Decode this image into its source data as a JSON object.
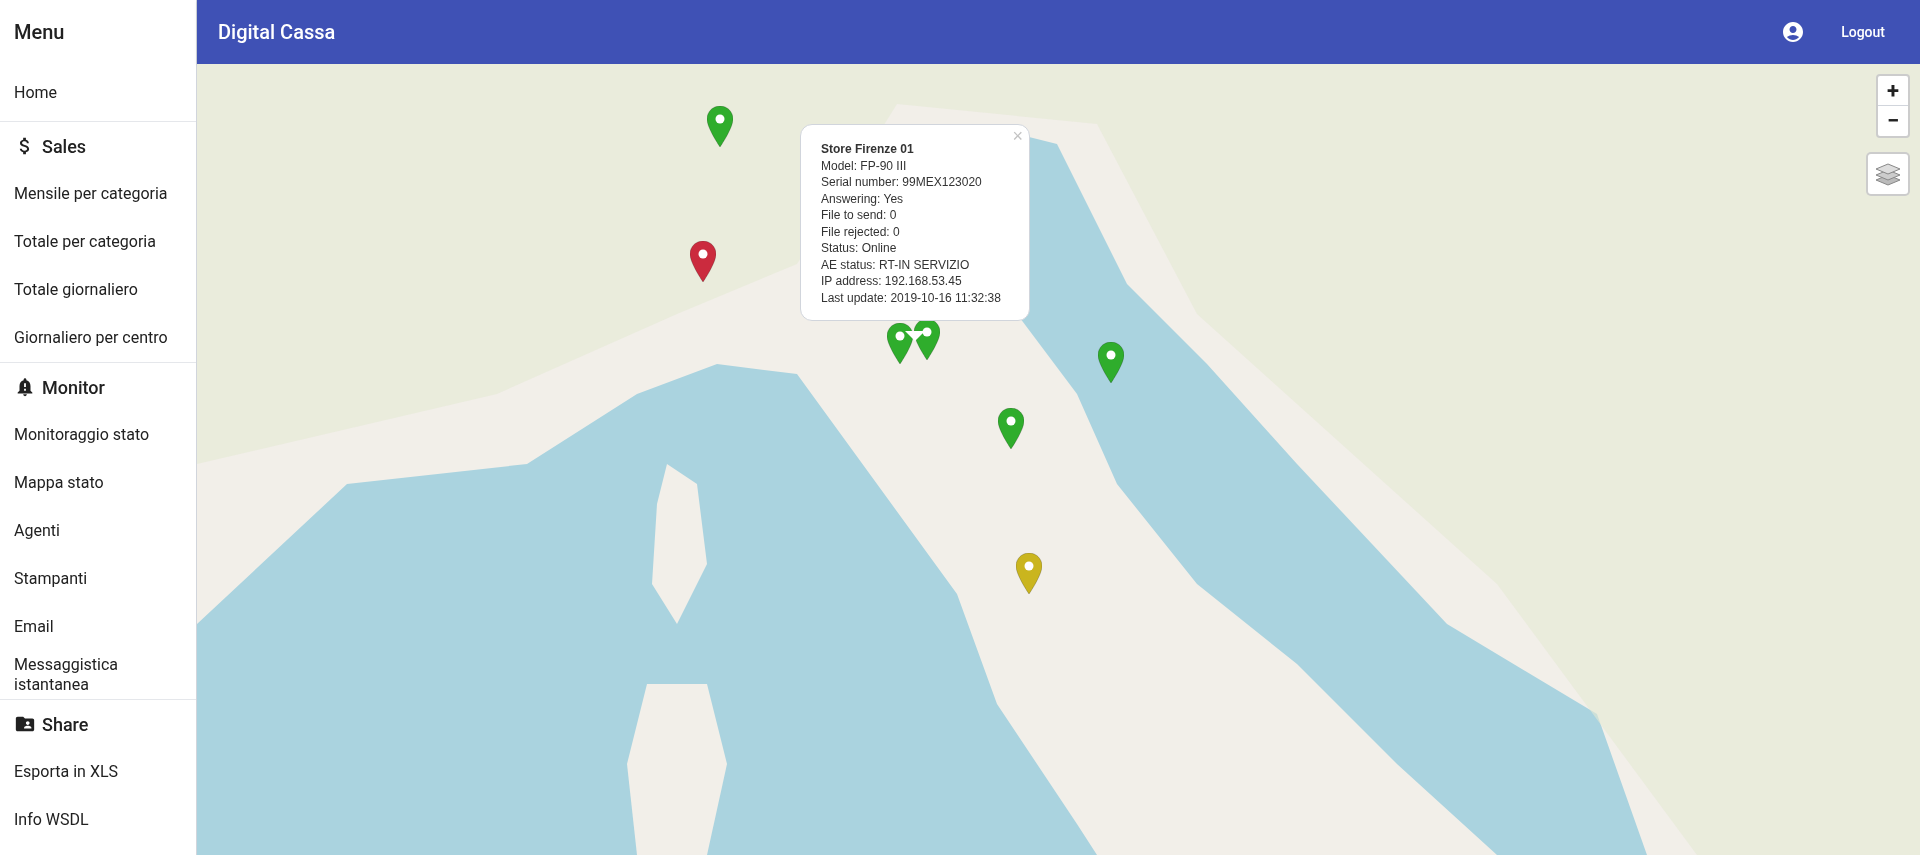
{
  "sidebar": {
    "title": "Menu",
    "home": "Home",
    "sections": [
      {
        "heading": "Sales",
        "items": [
          "Mensile per categoria",
          "Totale per categoria",
          "Totale giornaliero",
          "Giornaliero per centro"
        ]
      },
      {
        "heading": "Monitor",
        "items": [
          "Monitoraggio stato",
          "Mappa stato",
          "Agenti",
          "Stampanti",
          "Email",
          "Messaggistica istantanea"
        ]
      },
      {
        "heading": "Share",
        "items": [
          "Esporta in XLS",
          "Info WSDL"
        ]
      }
    ]
  },
  "header": {
    "title": "Digital Cassa",
    "logout": "Logout"
  },
  "map": {
    "zoom_in": "+",
    "zoom_out": "−",
    "markers": [
      {
        "color": "#2fad2c"
      },
      {
        "color": "#cb2b3e"
      },
      {
        "color": "#2fad2c"
      },
      {
        "color": "#2fad2c"
      },
      {
        "color": "#2fad2c"
      },
      {
        "color": "#2fad2c"
      },
      {
        "color": "#cab51e"
      }
    ],
    "popup": {
      "close": "×",
      "title": "Store Firenze 01",
      "lines": [
        "Model: FP-90 III",
        "Serial number: 99MEX123020",
        "Answering: Yes",
        "File to send: 0",
        "File rejected: 0",
        "Status: Online",
        "AE status: RT-IN SERVIZIO",
        "IP address: 192.168.53.45",
        "Last update: 2019-10-16 11:32:38"
      ]
    }
  }
}
